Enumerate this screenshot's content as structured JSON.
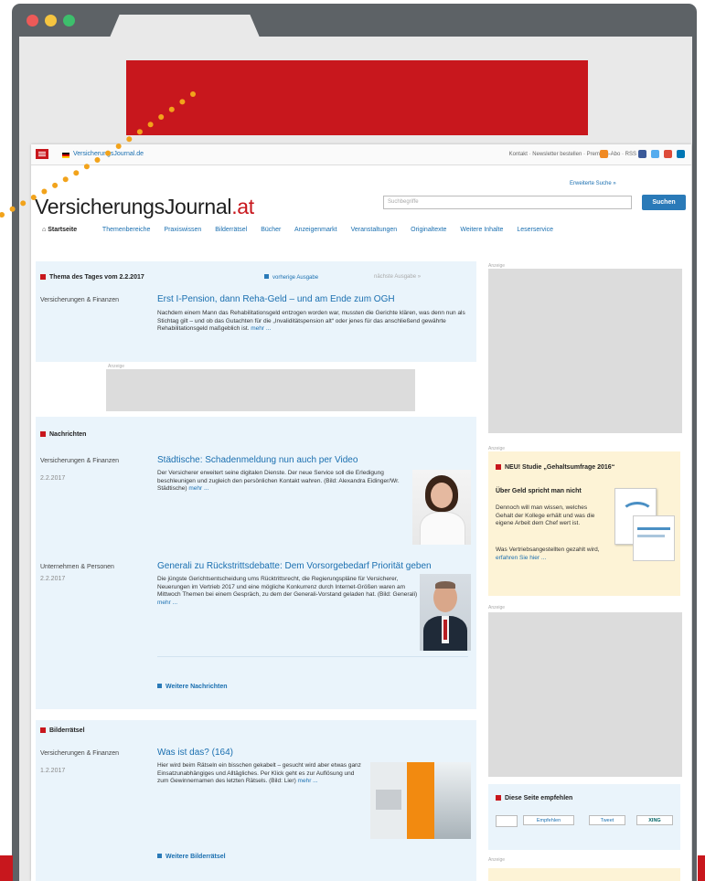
{
  "browser": {
    "dot_colors": [
      "#ed5a58",
      "#f5c540",
      "#3dbf6c"
    ]
  },
  "site": {
    "url": "VersicherungsJournal.de",
    "top_links": "Kontakt · Newsletter bestellen · Premium-Abo · RSS",
    "logo_main": "VersicherungsJournal",
    "logo_tld": ".at",
    "advanced_search": "Erweiterte Suche »",
    "search_placeholder": "Suchbegriffe",
    "search_button": "Suchen",
    "nav": [
      "Startseite",
      "Themenbereiche",
      "Praxiswissen",
      "Bilderrätsel",
      "Bücher",
      "Anzeigenmarkt",
      "Veranstaltungen",
      "Originaltexte",
      "Weitere Inhalte",
      "Leserservice"
    ]
  },
  "thema": {
    "header": "Thema des Tages vom 2.2.2017",
    "prev": "vorherige Ausgabe",
    "next": "nächste Ausgabe »",
    "category": "Versicherungen & Finanzen",
    "headline": "Erst I-Pension, dann Reha-Geld – und am Ende zum OGH",
    "body": "Nachdem einem Mann das Rehabilitationsgeld entzogen worden war, mussten die Gerichte klären, was denn nun als Stichtag gilt – und ob das Gutachten für die „Invaliditätspension alt“ oder jenes für das anschließend gewährte Rehabilitationsgeld maßgeblich ist.",
    "more": "mehr ..."
  },
  "ad_label": "Anzeige",
  "news": {
    "header": "Nachrichten",
    "items": [
      {
        "category": "Versicherungen & Finanzen",
        "date": "2.2.2017",
        "headline": "Städtische: Schadenmeldung nun auch per Video",
        "body": "Der Versicherer erweitert seine digitalen Dienste. Der neue Service soll die Erledigung beschleunigen und zugleich den persönlichen Kontakt wahren. (Bild: Alexandra Eidinger/Wr. Städtische)",
        "more": "mehr ..."
      },
      {
        "category": "Unternehmen & Personen",
        "date": "2.2.2017",
        "headline": "Generali zu Rückstrittsdebatte: Dem Vorsorgebedarf Priorität geben",
        "body": "Die jüngste Gerichtsentscheidung ums Rücktrittsrecht, die Regierungspläne für Versicherer, Neuerungen im Vertrieb 2017 und eine mögliche Konkurrenz durch Internet-Größen waren am Mittwoch Themen bei einem Gespräch, zu dem der Generali-Vorstand geladen hat. (Bild: Generali)",
        "more": "mehr ..."
      }
    ],
    "more_link": "Weitere Nachrichten"
  },
  "raetsel": {
    "header": "Bilderrätsel",
    "category": "Versicherungen & Finanzen",
    "date": "1.2.2017",
    "headline": "Was ist das? (164)",
    "body": "Hier wird beim Rätseln ein bisschen gekabelt – gesucht wird aber etwas ganz Einsatzunabhängiges und Alltägliches. Per Klick geht es zur Auflösung und zum Gewinnernamen des letzten Rätsels. (Bild: Lier)",
    "more": "mehr ...",
    "more_link": "Weitere Bilderrätsel"
  },
  "sidebar": {
    "studie_title": "NEU! Studie „Gehaltsumfrage 2016“",
    "studie_sub": "Über Geld spricht man nicht",
    "studie_body": "Dennoch will man wissen, welches Gehalt der Kollege erhält und was die eigene Arbeit dem Chef wert ist.",
    "studie_body2": "Was Vertriebsangestellten gezahlt wird,",
    "studie_link": "erfahren Sie hier ...",
    "empfehlen_title": "Diese Seite empfehlen",
    "empfehlen_buttons": [
      "Empfehlen",
      "Tweet",
      "XING"
    ]
  }
}
